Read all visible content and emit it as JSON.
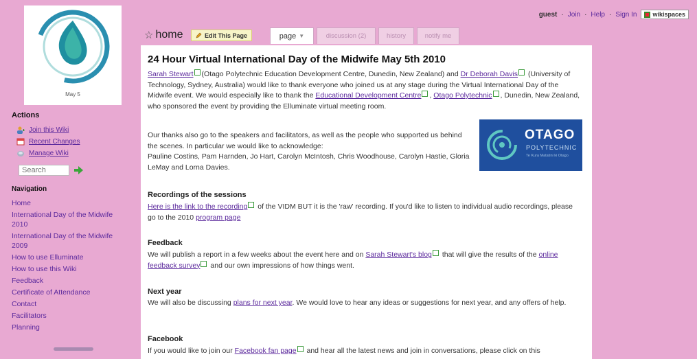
{
  "colors": {
    "background": "#e8a9d2",
    "link": "#5c2a9d",
    "otago_blue": "#1f4f9e"
  },
  "sidebar": {
    "logo_caption": "May 5",
    "actions_title": "Actions",
    "actions": [
      {
        "label": "Join this Wiki",
        "icon": "join-user-icon"
      },
      {
        "label": "Recent Changes",
        "icon": "calendar-icon"
      },
      {
        "label": "Manage Wiki",
        "icon": "manage-icon"
      }
    ],
    "search_placeholder": "Search",
    "navigation_title": "Navigation",
    "nav": [
      "Home",
      "International Day of the Midwife 2010",
      "International Day of the Midwife 2009",
      "How to use Elluminate",
      "How to use this Wiki",
      "Feedback",
      "Certificate of Attendance",
      "Contact",
      "Facilitators",
      "Planning"
    ]
  },
  "header": {
    "guest": "guest",
    "join": "Join",
    "help": "Help",
    "sign_in": "Sign In",
    "brand": "wikispaces",
    "home": "home",
    "edit_button": "Edit This Page",
    "tabs": {
      "page": "page",
      "discussion": "discussion (2)",
      "history": "history",
      "notify": "notify me"
    }
  },
  "content": {
    "heading": "24 Hour Virtual International Day of the Midwife May 5th 2010",
    "intro": {
      "sarah": "Sarah Stewart",
      "t1": "(Otago Polytechnic Education Development Centre, Dunedin, New Zealand) and",
      "deborah": "Dr Deborah Davis",
      "t2": "(University of Technology, Sydney, Australia) would like to thank everyone who joined us at any stage during the Virtual International Day of the Midwife event. We would especially like to thank the",
      "edc": "Educational Development Centre",
      "otago": "Otago Polytechnic",
      "t3": ", Dunedin, New Zealand, who sponsored the event by providing the Elluminate virtual meeting room."
    },
    "thanks": "Our thanks also go to the speakers and facilitators, as well as the people who supported us behind the scenes. In particular we would like to acknowledge:",
    "acknowledged": "Pauline Costins, Pam Harnden, Jo Hart, Carolyn McIntosh, Chris Woodhouse, Carolyn Hastie, Gloria LeMay and Lorna Davies.",
    "otago_logo": {
      "name": "OTAGO",
      "sub": "POLYTECHNIC",
      "tag": "Te Kura Matatini ki Otago"
    },
    "recordings": {
      "title": "Recordings of the sessions",
      "link": "Here is the link to the recording",
      "t1": "of the VIDM BUT it is the 'raw' recording. If you'd like to listen to individual audio recordings, please go to the 2010",
      "link2": "program page"
    },
    "feedback": {
      "title": "Feedback",
      "t1": "We will publish a report in a few weeks about the event here and on",
      "link1": "Sarah Stewart's blog",
      "t2": "that will give the results of the",
      "link2": "online feedback survey",
      "t3": "and our own impressions of how things went."
    },
    "next_year": {
      "title": "Next year",
      "t1": "We will also be discussing",
      "link": "plans for next year",
      "t2": ". We would love to hear any ideas or suggestions for next year, and any offers of help."
    },
    "facebook": {
      "title": "Facebook",
      "t1": "If you would like to join our",
      "link": "Facebook fan page",
      "t2": "and hear all the latest news and join in conversations, please click on this"
    }
  }
}
